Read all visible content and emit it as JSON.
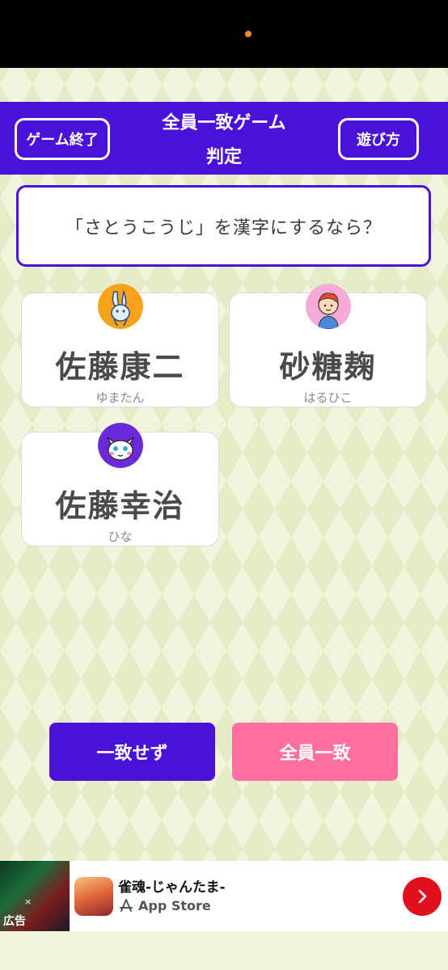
{
  "header": {
    "quit_label": "ゲーム終了",
    "title_line1": "全員一致ゲーム",
    "title_line2": "判定",
    "howto_label": "遊び方"
  },
  "question": "「さとうこうじ」を漢字にするなら？",
  "answers": [
    {
      "answer": "佐藤康二",
      "player": "ゆまたん",
      "avatar": "rabbit-avatar-icon"
    },
    {
      "answer": "砂糖麹",
      "player": "はるひこ",
      "avatar": "boy-avatar-icon"
    },
    {
      "answer": "佐藤幸治",
      "player": "ひな",
      "avatar": "cat-avatar-icon"
    }
  ],
  "actions": {
    "no_match_label": "一致せず",
    "all_match_label": "全員一致"
  },
  "ad": {
    "label": "広告",
    "x_mark": "×",
    "app_title": "雀魂-じゃんたま-",
    "store": "App Store"
  },
  "colors": {
    "primary": "#4a12d8",
    "accent_pink": "#ff6ea0",
    "background": "#f2f5dc",
    "ad_arrow": "#e0111d"
  }
}
